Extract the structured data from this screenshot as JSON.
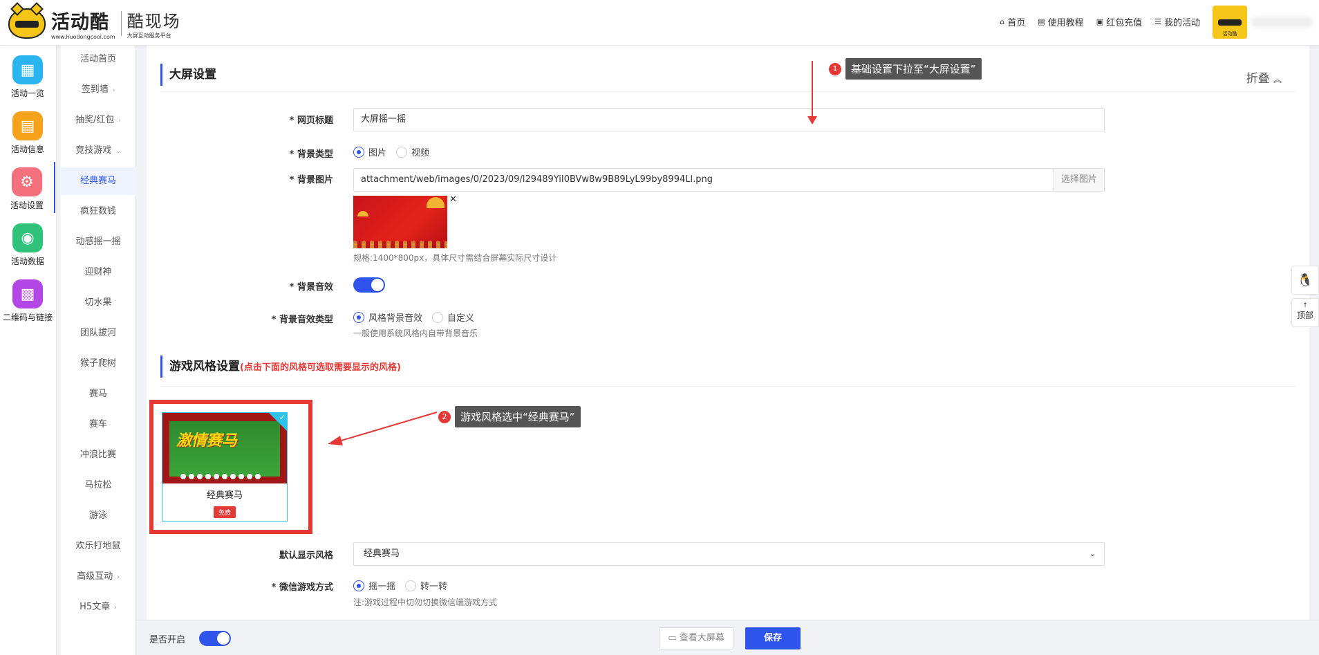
{
  "header": {
    "logo_main": "活动酷",
    "logo_url": "www.huodongcool.com",
    "logo_sub_main": "酷现场",
    "logo_sub_small": "大屏互动服务平台",
    "nav": [
      {
        "label": "首页",
        "icon": "home-icon"
      },
      {
        "label": "使用教程",
        "icon": "book-icon"
      },
      {
        "label": "红包充值",
        "icon": "wallet-icon"
      },
      {
        "label": "我的活动",
        "icon": "list-icon"
      }
    ],
    "avatar_tag": "活动酷"
  },
  "icon_sidebar": [
    {
      "label": "活动一览",
      "icon": "grid-icon",
      "color": "#2bb5f0"
    },
    {
      "label": "活动信息",
      "icon": "document-icon",
      "color": "#f7a21b"
    },
    {
      "label": "活动设置",
      "icon": "gear-icon",
      "color": "#f4707c",
      "active": true
    },
    {
      "label": "活动数据",
      "icon": "database-icon",
      "color": "#2fc27a"
    },
    {
      "label": "二维码与链接",
      "icon": "qrcode-icon",
      "color": "#b546e6"
    }
  ],
  "sub_sidebar": [
    {
      "label": "活动首页",
      "arrow": ""
    },
    {
      "label": "签到墙",
      "arrow": "›"
    },
    {
      "label": "抽奖/红包",
      "arrow": "›"
    },
    {
      "label": "竞技游戏",
      "arrow": "⌄"
    },
    {
      "label": "经典赛马",
      "arrow": "",
      "active": true
    },
    {
      "label": "疯狂数钱",
      "arrow": ""
    },
    {
      "label": "动感摇一摇",
      "arrow": ""
    },
    {
      "label": "迎财神",
      "arrow": ""
    },
    {
      "label": "切水果",
      "arrow": ""
    },
    {
      "label": "团队拔河",
      "arrow": ""
    },
    {
      "label": "猴子爬树",
      "arrow": ""
    },
    {
      "label": "赛马",
      "arrow": ""
    },
    {
      "label": "赛车",
      "arrow": ""
    },
    {
      "label": "冲浪比赛",
      "arrow": ""
    },
    {
      "label": "马拉松",
      "arrow": ""
    },
    {
      "label": "游泳",
      "arrow": ""
    },
    {
      "label": "欢乐打地鼠",
      "arrow": ""
    },
    {
      "label": "高级互动",
      "arrow": "›"
    },
    {
      "label": "H5文章",
      "arrow": "›"
    }
  ],
  "screen_settings": {
    "title": "大屏设置",
    "collapse_label": "折叠",
    "collapse_icon": "︽",
    "page_title_label": "* 网页标题",
    "page_title_value": "大屏摇一摇",
    "bg_type_label": "* 背景类型",
    "bg_type_options": [
      "图片",
      "视频"
    ],
    "bg_image_label": "* 背景图片",
    "bg_image_value": "attachment/web/images/0/2023/09/l29489YiI0BVw8w9B89LyL99by8994Ll.png",
    "bg_image_button": "选择图片",
    "bg_image_hint": "规格:1400*800px，具体尺寸需结合屏幕实际尺寸设计",
    "bg_sound_label": "* 背景音效",
    "bg_sound_type_label": "* 背景音效类型",
    "bg_sound_type_options": [
      "风格背景音效",
      "自定义"
    ],
    "bg_sound_hint": "一般使用系统风格内自带背景音乐"
  },
  "game_style": {
    "title": "游戏风格设置",
    "hint": "(点击下面的风格可选取需要显示的风格)",
    "card_name": "经典赛马",
    "card_badge": "免费",
    "card_art_text": "激情赛马",
    "default_style_label": "默认显示风格",
    "default_style_value": "经典赛马",
    "wechat_mode_label": "* 微信游戏方式",
    "wechat_mode_options": [
      "摇一摇",
      "转一转"
    ],
    "wechat_mode_hint": "注:游戏过程中切勿切换微信端游戏方式"
  },
  "annotations": [
    {
      "num": "1",
      "text": "基础设置下拉至“大屏设置”"
    },
    {
      "num": "2",
      "text": "游戏风格选中“经典赛马”"
    }
  ],
  "float": {
    "top_label": "顶部"
  },
  "bottom": {
    "enable_label": "是否开启",
    "view_button": "查看大屏幕",
    "save_button": "保存"
  },
  "colors": {
    "accent": "#2f54eb",
    "danger": "#e53935",
    "card_border": "#2ec3e8"
  }
}
